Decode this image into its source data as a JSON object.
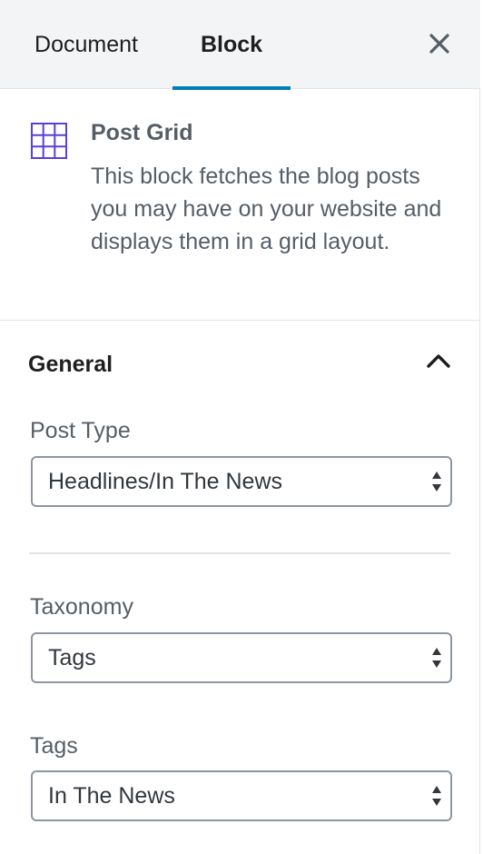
{
  "tabs": {
    "document_label": "Document",
    "block_label": "Block",
    "active": "Block"
  },
  "block_card": {
    "title": "Post Grid",
    "description": "This block fetches the blog posts you may have on your website and displays them in a grid layout.",
    "icon": "grid-icon",
    "icon_color": "#5b3fd6"
  },
  "general": {
    "title": "General",
    "expanded": true,
    "fields": {
      "post_type": {
        "label": "Post Type",
        "value": "Headlines/In The News"
      },
      "taxonomy": {
        "label": "Taxonomy",
        "value": "Tags"
      },
      "tags": {
        "label": "Tags",
        "value": "In The News"
      }
    }
  },
  "colors": {
    "accent": "#007cba",
    "text_muted": "#555d66",
    "tab_bar_bg": "#f3f4f5"
  }
}
